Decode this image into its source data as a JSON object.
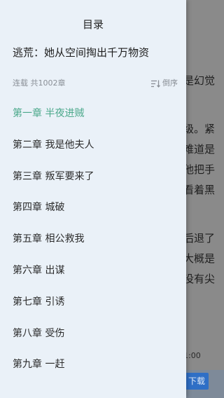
{
  "colors": {
    "drawer_bg": "#eaf1f8",
    "active_chapter": "#4aa88a",
    "muted_text": "#8a8f96",
    "download_button": "#2f6fc6"
  },
  "drawer": {
    "title": "目录",
    "book_title": "逃荒：她从空间掏出千万物资",
    "status": "连载 共1002章",
    "sort_label": "倒序",
    "sort_icon": "sort-desc-icon"
  },
  "chapters": [
    {
      "label": "第一章 半夜进贼",
      "active": true
    },
    {
      "label": "第二章 我是他夫人",
      "active": false
    },
    {
      "label": "第三章 叛军要来了",
      "active": false
    },
    {
      "label": "第四章 城破",
      "active": false
    },
    {
      "label": "第五章 相公救我",
      "active": false
    },
    {
      "label": "第六章 出谋",
      "active": false
    },
    {
      "label": "第七章 引诱",
      "active": false
    },
    {
      "label": "第八章 受伤",
      "active": false
    },
    {
      "label": "第九章 一赶",
      "active": false
    }
  ],
  "reader": {
    "lines": [
      "是幻觉",
      "级。紧",
      "难道是",
      "他把手",
      "看着黑",
      "后退了",
      "大概是",
      "没有尖"
    ],
    "time": "1:00",
    "download_label": "下载"
  }
}
